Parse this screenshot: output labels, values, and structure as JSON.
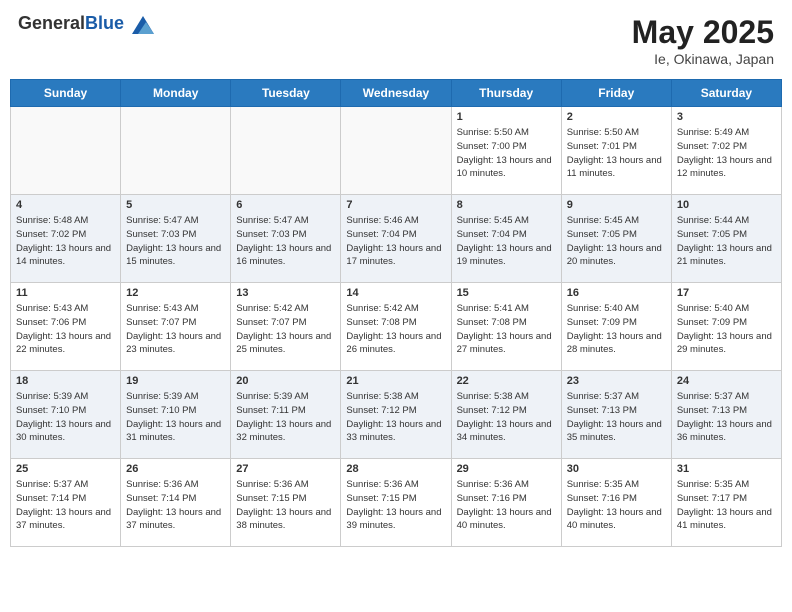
{
  "header": {
    "logo_general": "General",
    "logo_blue": "Blue",
    "month_year": "May 2025",
    "location": "Ie, Okinawa, Japan"
  },
  "weekdays": [
    "Sunday",
    "Monday",
    "Tuesday",
    "Wednesday",
    "Thursday",
    "Friday",
    "Saturday"
  ],
  "weeks": [
    [
      {
        "day": "",
        "empty": true
      },
      {
        "day": "",
        "empty": true
      },
      {
        "day": "",
        "empty": true
      },
      {
        "day": "",
        "empty": true
      },
      {
        "day": "1",
        "sunrise": "5:50 AM",
        "sunset": "7:00 PM",
        "daylight": "13 hours and 10 minutes."
      },
      {
        "day": "2",
        "sunrise": "5:50 AM",
        "sunset": "7:01 PM",
        "daylight": "13 hours and 11 minutes."
      },
      {
        "day": "3",
        "sunrise": "5:49 AM",
        "sunset": "7:02 PM",
        "daylight": "13 hours and 12 minutes."
      }
    ],
    [
      {
        "day": "4",
        "sunrise": "5:48 AM",
        "sunset": "7:02 PM",
        "daylight": "13 hours and 14 minutes."
      },
      {
        "day": "5",
        "sunrise": "5:47 AM",
        "sunset": "7:03 PM",
        "daylight": "13 hours and 15 minutes."
      },
      {
        "day": "6",
        "sunrise": "5:47 AM",
        "sunset": "7:03 PM",
        "daylight": "13 hours and 16 minutes."
      },
      {
        "day": "7",
        "sunrise": "5:46 AM",
        "sunset": "7:04 PM",
        "daylight": "13 hours and 17 minutes."
      },
      {
        "day": "8",
        "sunrise": "5:45 AM",
        "sunset": "7:04 PM",
        "daylight": "13 hours and 19 minutes."
      },
      {
        "day": "9",
        "sunrise": "5:45 AM",
        "sunset": "7:05 PM",
        "daylight": "13 hours and 20 minutes."
      },
      {
        "day": "10",
        "sunrise": "5:44 AM",
        "sunset": "7:05 PM",
        "daylight": "13 hours and 21 minutes."
      }
    ],
    [
      {
        "day": "11",
        "sunrise": "5:43 AM",
        "sunset": "7:06 PM",
        "daylight": "13 hours and 22 minutes."
      },
      {
        "day": "12",
        "sunrise": "5:43 AM",
        "sunset": "7:07 PM",
        "daylight": "13 hours and 23 minutes."
      },
      {
        "day": "13",
        "sunrise": "5:42 AM",
        "sunset": "7:07 PM",
        "daylight": "13 hours and 25 minutes."
      },
      {
        "day": "14",
        "sunrise": "5:42 AM",
        "sunset": "7:08 PM",
        "daylight": "13 hours and 26 minutes."
      },
      {
        "day": "15",
        "sunrise": "5:41 AM",
        "sunset": "7:08 PM",
        "daylight": "13 hours and 27 minutes."
      },
      {
        "day": "16",
        "sunrise": "5:40 AM",
        "sunset": "7:09 PM",
        "daylight": "13 hours and 28 minutes."
      },
      {
        "day": "17",
        "sunrise": "5:40 AM",
        "sunset": "7:09 PM",
        "daylight": "13 hours and 29 minutes."
      }
    ],
    [
      {
        "day": "18",
        "sunrise": "5:39 AM",
        "sunset": "7:10 PM",
        "daylight": "13 hours and 30 minutes."
      },
      {
        "day": "19",
        "sunrise": "5:39 AM",
        "sunset": "7:10 PM",
        "daylight": "13 hours and 31 minutes."
      },
      {
        "day": "20",
        "sunrise": "5:39 AM",
        "sunset": "7:11 PM",
        "daylight": "13 hours and 32 minutes."
      },
      {
        "day": "21",
        "sunrise": "5:38 AM",
        "sunset": "7:12 PM",
        "daylight": "13 hours and 33 minutes."
      },
      {
        "day": "22",
        "sunrise": "5:38 AM",
        "sunset": "7:12 PM",
        "daylight": "13 hours and 34 minutes."
      },
      {
        "day": "23",
        "sunrise": "5:37 AM",
        "sunset": "7:13 PM",
        "daylight": "13 hours and 35 minutes."
      },
      {
        "day": "24",
        "sunrise": "5:37 AM",
        "sunset": "7:13 PM",
        "daylight": "13 hours and 36 minutes."
      }
    ],
    [
      {
        "day": "25",
        "sunrise": "5:37 AM",
        "sunset": "7:14 PM",
        "daylight": "13 hours and 37 minutes."
      },
      {
        "day": "26",
        "sunrise": "5:36 AM",
        "sunset": "7:14 PM",
        "daylight": "13 hours and 37 minutes."
      },
      {
        "day": "27",
        "sunrise": "5:36 AM",
        "sunset": "7:15 PM",
        "daylight": "13 hours and 38 minutes."
      },
      {
        "day": "28",
        "sunrise": "5:36 AM",
        "sunset": "7:15 PM",
        "daylight": "13 hours and 39 minutes."
      },
      {
        "day": "29",
        "sunrise": "5:36 AM",
        "sunset": "7:16 PM",
        "daylight": "13 hours and 40 minutes."
      },
      {
        "day": "30",
        "sunrise": "5:35 AM",
        "sunset": "7:16 PM",
        "daylight": "13 hours and 40 minutes."
      },
      {
        "day": "31",
        "sunrise": "5:35 AM",
        "sunset": "7:17 PM",
        "daylight": "13 hours and 41 minutes."
      }
    ]
  ]
}
